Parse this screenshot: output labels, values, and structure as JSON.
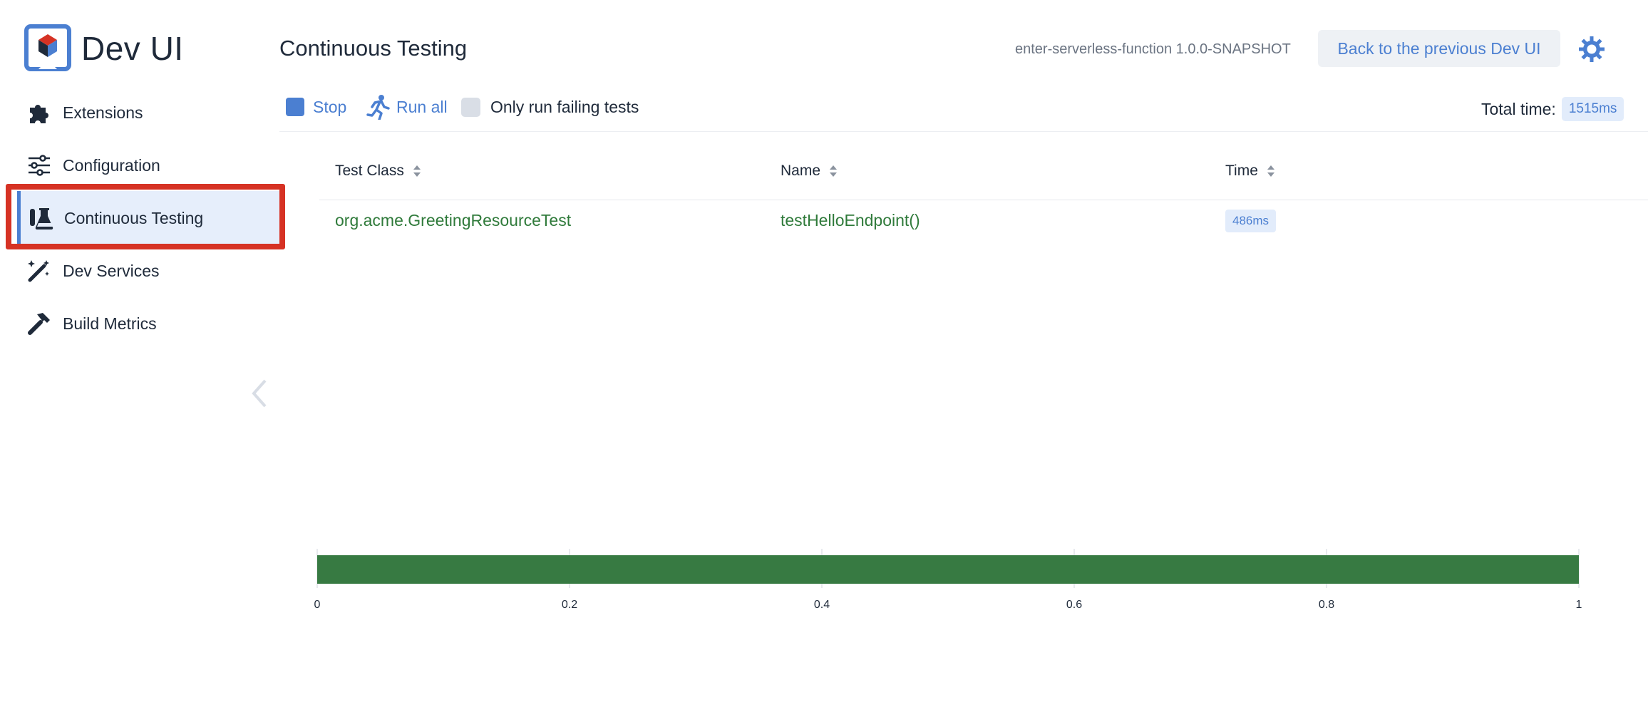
{
  "brand": {
    "title": "Dev UI"
  },
  "sidebar": {
    "items": [
      {
        "label": "Extensions",
        "icon": "puzzle-icon",
        "active": false
      },
      {
        "label": "Configuration",
        "icon": "sliders-icon",
        "active": false
      },
      {
        "label": "Continuous Testing",
        "icon": "flask-icon",
        "active": true
      },
      {
        "label": "Dev Services",
        "icon": "magic-wand-icon",
        "active": false
      },
      {
        "label": "Build Metrics",
        "icon": "hammer-icon",
        "active": false
      }
    ]
  },
  "header": {
    "page_title": "Continuous Testing",
    "app_version": "enter-serverless-function 1.0.0-SNAPSHOT",
    "back_label": "Back to the previous Dev UI"
  },
  "toolbar": {
    "stop_label": "Stop",
    "run_all_label": "Run all",
    "only_failing_label": "Only run failing tests",
    "only_failing_checked": false,
    "total_time_label": "Total time:",
    "total_time_value": "1515ms"
  },
  "table": {
    "columns": [
      "Test Class",
      "Name",
      "Time"
    ],
    "rows": [
      {
        "test_class": "org.acme.GreetingResourceTest",
        "name": "testHelloEndpoint()",
        "time": "486ms"
      }
    ]
  },
  "chart_data": {
    "type": "bar",
    "orientation": "horizontal",
    "values": [
      1
    ],
    "xlim": [
      0,
      1
    ],
    "ticks": [
      "0",
      "0.2",
      "0.4",
      "0.6",
      "0.8",
      "1"
    ],
    "tick_values": [
      0,
      0.2,
      0.4,
      0.6,
      0.8,
      1
    ],
    "bar_color": "#377a42"
  },
  "colors": {
    "accent": "#4b7fd1",
    "success": "#2f7a3a",
    "highlight": "#d63224"
  }
}
